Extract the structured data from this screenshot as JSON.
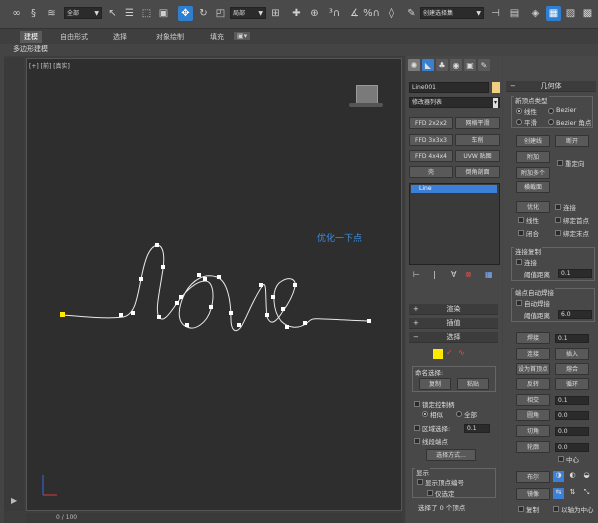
{
  "toolbar": {
    "selection_filter": "全部",
    "ref_coord": "局部",
    "named_selection": "创建选择集"
  },
  "ribbon": {
    "tabs": [
      "建模",
      "自由形式",
      "选择",
      "对象绘制",
      "填充"
    ],
    "sub_label": "多边形建模"
  },
  "viewport": {
    "label": "[+] [前] [真实]",
    "annotation": "优化一下点",
    "spline_color": "#e8e8e8",
    "first_vertex_color": "#ffeb00"
  },
  "status": {
    "frame": "0 / 100"
  },
  "command_panel": {
    "object_name": "Line001",
    "modifier_list": "修改器列表",
    "modifier_buttons": [
      "FFD 2x2x2",
      "网格平滑",
      "FFD 3x3x3",
      "车削",
      "FFD 4x4x4",
      "UVW 贴图",
      "壳",
      "倒角剖面"
    ],
    "stack_item": "Line",
    "rollouts": [
      "渲染",
      "插值",
      "选择"
    ],
    "named_selection_label": "命名选择:",
    "copy_btn": "复制",
    "paste_btn": "粘贴",
    "lock_handles": "锁定控制柄",
    "similar": "相似",
    "all": "全部",
    "area_select": "区域选择:",
    "area_value": "0.1",
    "segment_end": "线段端点",
    "select_by": "选择方式...",
    "display_label": "显示",
    "show_vertex_numbers": "显示顶点编号",
    "selected_only": "仅选定",
    "selected_count": "选择了 0 个顶点"
  },
  "geometry_panel": {
    "title": "几何体",
    "new_vertex_type": "新顶点类型",
    "linear": "线性",
    "bezier": "Bezier",
    "smooth": "平滑",
    "bezier_corner": "Bezier 角点",
    "create_line": "创建线",
    "break": "断开",
    "attach": "附加",
    "reorient": "重定向",
    "attach_mult": "附加多个",
    "cross_section": "横截面",
    "refine": "优化",
    "connect": "连接",
    "linear2": "线性",
    "bind_first": "绑定首点",
    "closed": "闭合",
    "bind_last": "绑定末点",
    "connect_copy": "连接复制",
    "connect_cb": "连接",
    "threshold_label": "阈值距离",
    "threshold_value": "0.1",
    "auto_weld": "端点自动焊接",
    "auto_weld_cb": "自动焊接",
    "weld_threshold_label": "阈值距离",
    "weld_threshold_value": "6.0",
    "weld": "焊接",
    "weld_val": "0.1",
    "connect2": "连接",
    "insert": "插入",
    "make_first": "设为首顶点",
    "fuse": "熔合",
    "reverse": "反转",
    "cycle": "循环",
    "cross_insert": "相交",
    "cross_val": "0.1",
    "fillet": "圆角",
    "fillet_val": "0.0",
    "chamfer": "切角",
    "chamfer_val": "0.0",
    "outline": "轮廓",
    "outline_val": "0.0",
    "center": "中心",
    "boolean": "布尔",
    "mirror": "镜像",
    "copy": "复制",
    "pivot_center": "以轴为中心"
  }
}
